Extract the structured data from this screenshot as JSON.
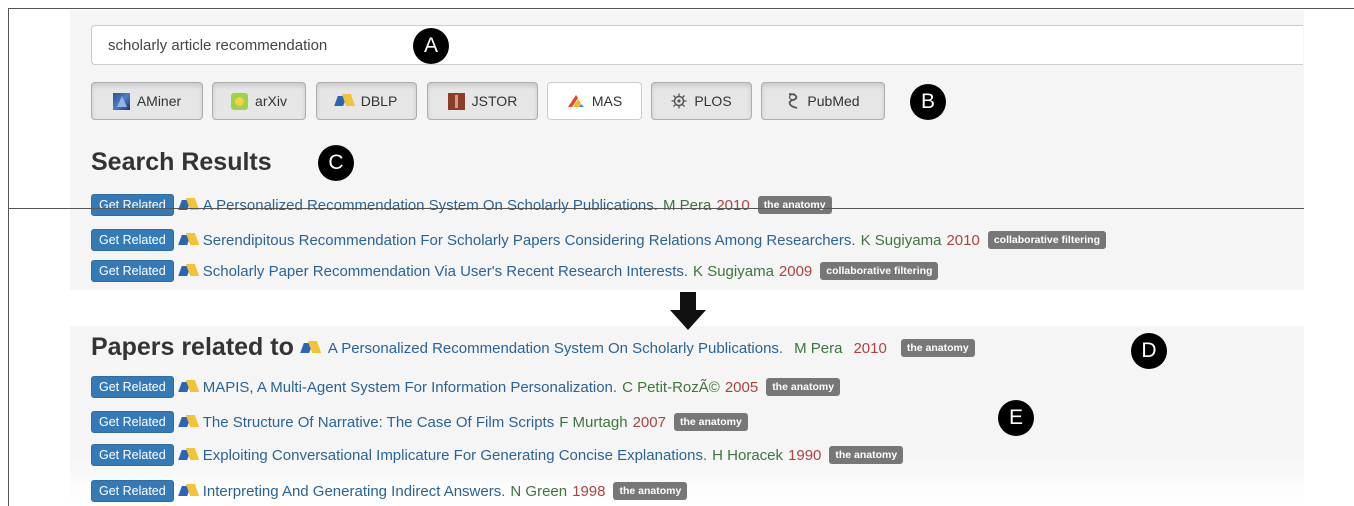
{
  "search": {
    "value": "scholarly article recommendation"
  },
  "markers": {
    "a": "A",
    "b": "B",
    "c": "C",
    "d": "D",
    "e": "E"
  },
  "sources": [
    {
      "label": "AMiner",
      "icon": "aminer-icon",
      "active": false
    },
    {
      "label": "arXiv",
      "icon": "arxiv-icon",
      "active": false
    },
    {
      "label": "DBLP",
      "icon": "dblp-icon",
      "active": false
    },
    {
      "label": "JSTOR",
      "icon": "jstor-icon",
      "active": false
    },
    {
      "label": "MAS",
      "icon": "mas-icon",
      "active": true
    },
    {
      "label": "PLOS",
      "icon": "plos-icon",
      "active": false
    },
    {
      "label": "PubMed",
      "icon": "pubmed-icon",
      "active": false
    }
  ],
  "results": {
    "heading": "Search Results",
    "button_label": "Get Related",
    "items": [
      {
        "title": "A Personalized Recommendation System On Scholarly Publications.",
        "author": "M Pera",
        "year": "2010",
        "tag": "the anatomy"
      },
      {
        "title": "Serendipitous Recommendation For Scholarly Papers Considering Relations Among Researchers.",
        "author": "K Sugiyama",
        "year": "2010",
        "tag": "collaborative filtering"
      },
      {
        "title": "Scholarly Paper Recommendation Via User's Recent Research Interests.",
        "author": "K Sugiyama",
        "year": "2009",
        "tag": "collaborative filtering"
      }
    ]
  },
  "related": {
    "heading": "Papers related to",
    "paper": {
      "title": "A Personalized Recommendation System On Scholarly Publications.",
      "author": "M Pera",
      "year": "2010",
      "tag": "the anatomy"
    },
    "button_label": "Get Related",
    "items": [
      {
        "title": "MAPIS, A Multi-Agent System For Information Personalization.",
        "author": "C Petit-RozÃ©",
        "year": "2005",
        "tag": "the anatomy"
      },
      {
        "title": "The Structure Of Narrative: The Case Of Film Scripts",
        "author": "F Murtagh",
        "year": "2007",
        "tag": "the anatomy"
      },
      {
        "title": "Exploiting Conversational Implicature For Generating Concise Explanations.",
        "author": "H Horacek",
        "year": "1990",
        "tag": "the anatomy"
      },
      {
        "title": "Interpreting And Generating Indirect Answers.",
        "author": "N Green",
        "year": "1998",
        "tag": "the anatomy"
      }
    ]
  },
  "colors": {
    "primary_button": "#337ab7",
    "title_link": "#2a6496",
    "author": "#3c763d",
    "year": "#a94442",
    "tag": "#777777"
  }
}
